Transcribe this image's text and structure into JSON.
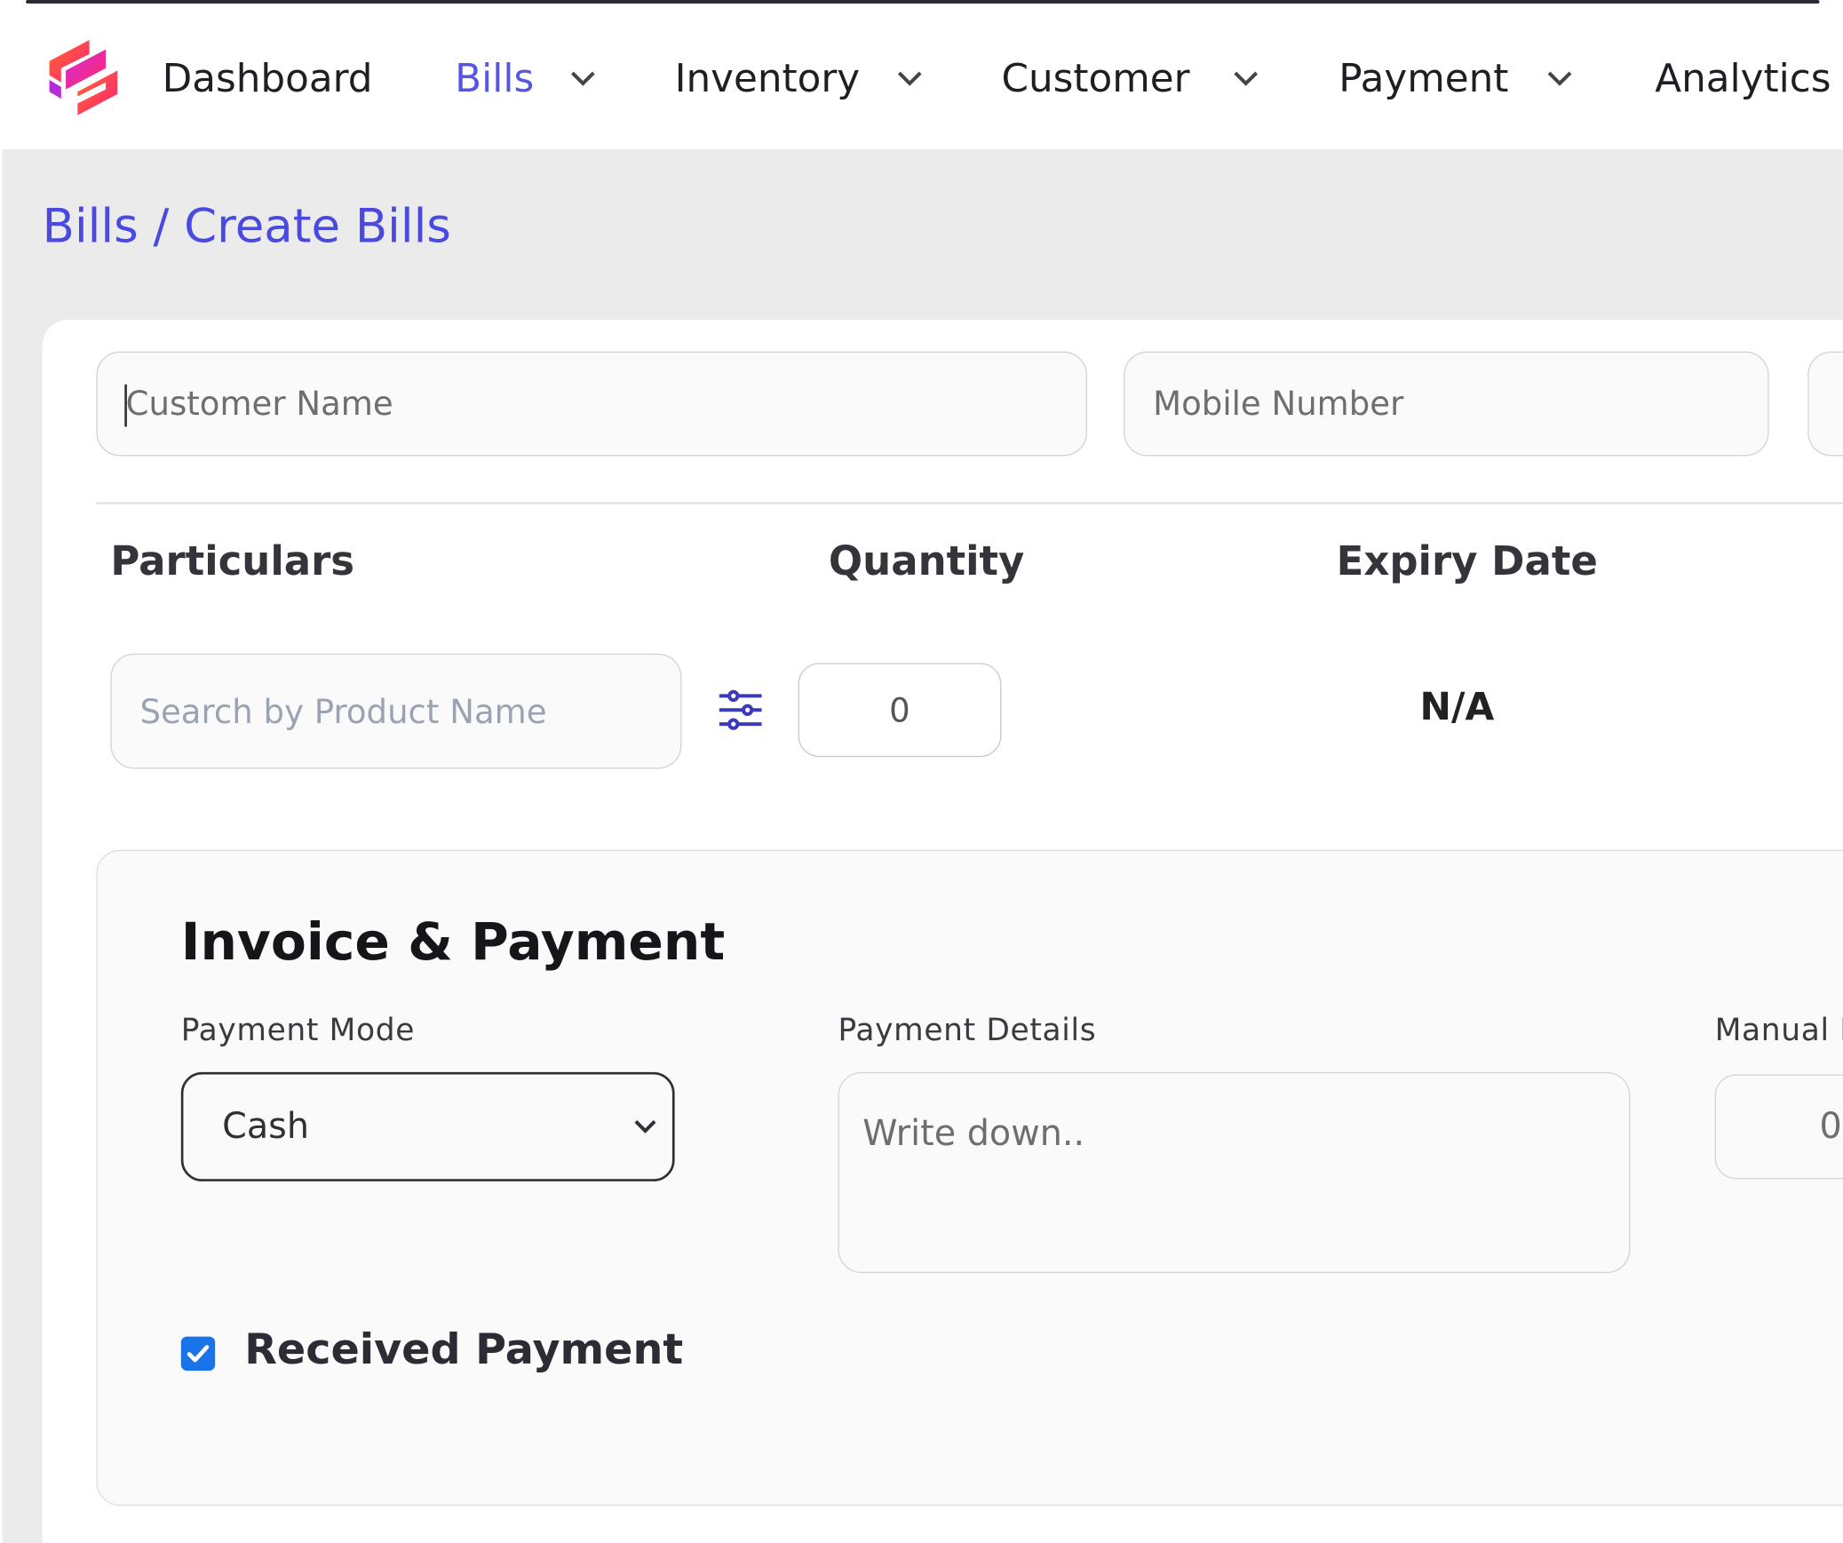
{
  "nav": {
    "items": [
      {
        "label": "Dashboard"
      },
      {
        "label": "Bills"
      },
      {
        "label": "Inventory"
      },
      {
        "label": "Customer"
      },
      {
        "label": "Payment"
      },
      {
        "label": "Analytics"
      }
    ],
    "active": "Bills",
    "accent_color": "#5656e0"
  },
  "breadcrumb": "Bills / Create Bills",
  "customer": {
    "name_placeholder": "Customer Name",
    "mobile_placeholder": "Mobile Number"
  },
  "table": {
    "headers": [
      "Particulars",
      "Quantity",
      "Expiry Date"
    ],
    "search_placeholder": "Search by Product Name",
    "quantity": "0",
    "expiry": "N/A"
  },
  "invoice": {
    "title": "Invoice & Payment",
    "payment_mode_label": "Payment Mode",
    "payment_mode_value": "Cash",
    "payment_details_label": "Payment Details",
    "payment_details_placeholder": "Write down..",
    "manual_label": "Manual I",
    "manual_value": "0",
    "received_label": "Received Payment",
    "received_checked": true
  }
}
